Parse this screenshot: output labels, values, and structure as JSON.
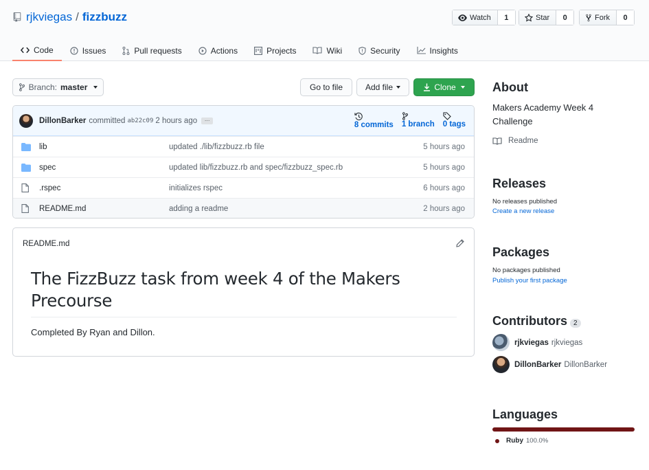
{
  "repo": {
    "owner": "rjkviegas",
    "separator": "/",
    "name": "fizzbuzz"
  },
  "header_buttons": {
    "watch": {
      "label": "Watch",
      "count": "1"
    },
    "star": {
      "label": "Star",
      "count": "0"
    },
    "fork": {
      "label": "Fork",
      "count": "0"
    }
  },
  "tabs": [
    {
      "label": "Code",
      "icon": "code-icon",
      "active": true
    },
    {
      "label": "Issues",
      "icon": "issue-icon"
    },
    {
      "label": "Pull requests",
      "icon": "pull-request-icon"
    },
    {
      "label": "Actions",
      "icon": "play-icon"
    },
    {
      "label": "Projects",
      "icon": "project-icon"
    },
    {
      "label": "Wiki",
      "icon": "book-icon"
    },
    {
      "label": "Security",
      "icon": "shield-icon"
    },
    {
      "label": "Insights",
      "icon": "graph-icon"
    }
  ],
  "toolbar": {
    "branch_prefix": "Branch:",
    "branch": "master",
    "go_to_file": "Go to file",
    "add_file": "Add file",
    "clone": "Clone"
  },
  "commit": {
    "author": "DillonBarker",
    "action": "committed",
    "sha": "ab22c09",
    "time": "2 hours ago",
    "ellipsis": "…",
    "commits": "8 commits",
    "branches": "1 branch",
    "tags": "0 tags"
  },
  "files": [
    {
      "type": "folder",
      "name": "lib",
      "message": "updated ./lib/fizzbuzz.rb file",
      "age": "5 hours ago"
    },
    {
      "type": "folder",
      "name": "spec",
      "message": "updated lib/fizzbuzz.rb and spec/fizzbuzz_spec.rb",
      "age": "5 hours ago"
    },
    {
      "type": "file",
      "name": ".rspec",
      "message": "initializes rspec",
      "age": "6 hours ago"
    },
    {
      "type": "file",
      "name": "README.md",
      "message": "adding a readme",
      "age": "2 hours ago"
    }
  ],
  "readme": {
    "filename": "README.md",
    "heading": "The FizzBuzz task from week 4 of the Makers Precourse",
    "body": "Completed By Ryan and Dillon."
  },
  "about": {
    "title": "About",
    "description": "Makers Academy Week 4 Challenge",
    "readme_link": "Readme"
  },
  "releases": {
    "title": "Releases",
    "none": "No releases published",
    "link": "Create a new release"
  },
  "packages": {
    "title": "Packages",
    "none": "No packages published",
    "link": "Publish your first package"
  },
  "contributors": {
    "title": "Contributors",
    "count": "2",
    "list": [
      {
        "login": "rjkviegas",
        "name": "rjkviegas"
      },
      {
        "login": "DillonBarker",
        "name": "DillonBarker"
      }
    ]
  },
  "languages": {
    "title": "Languages",
    "items": [
      {
        "name": "Ruby",
        "percent": "100.0%",
        "color": "#701516"
      }
    ]
  },
  "colors": {
    "accent": "#0366d6",
    "clone_green": "#2ea44f",
    "active_tab": "#f9826c"
  }
}
